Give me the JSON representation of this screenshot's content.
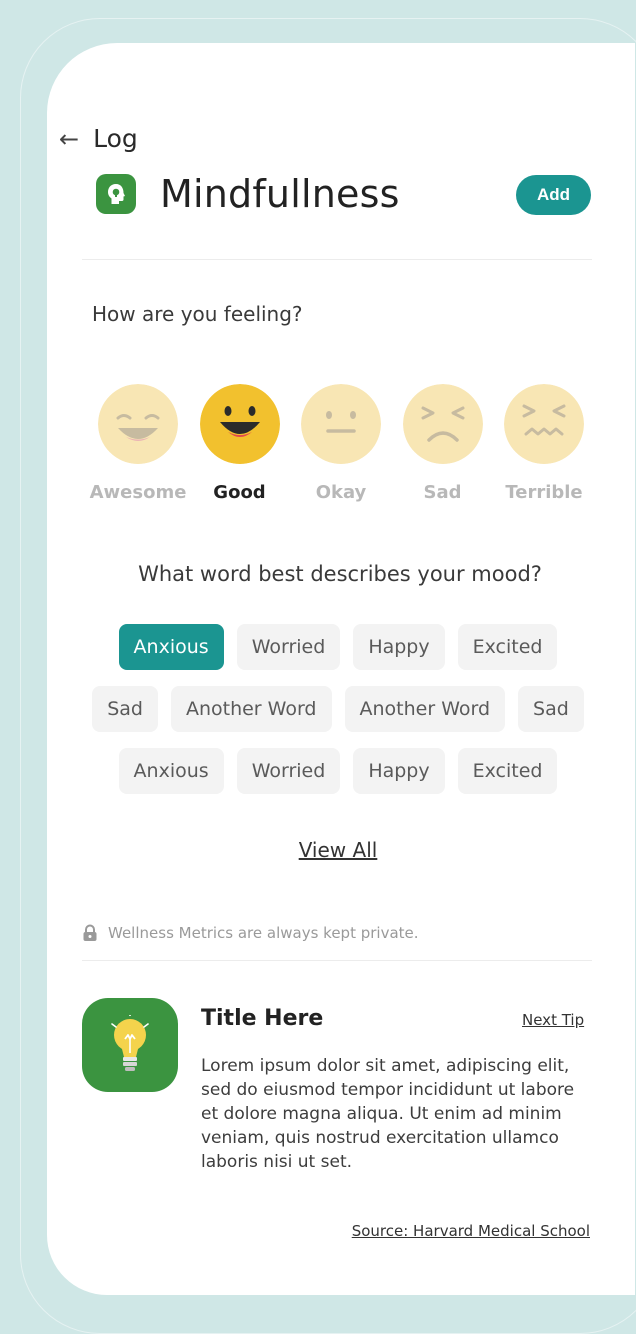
{
  "header": {
    "back_label": "Log",
    "title": "Mindfullness",
    "add_label": "Add"
  },
  "feeling": {
    "question": "How are you feeling?",
    "options": [
      {
        "label": "Awesome",
        "selected": false
      },
      {
        "label": "Good",
        "selected": true
      },
      {
        "label": "Okay",
        "selected": false
      },
      {
        "label": "Sad",
        "selected": false
      },
      {
        "label": "Terrible",
        "selected": false
      }
    ]
  },
  "mood": {
    "question": "What word best describes your mood?",
    "rows": [
      [
        "Anxious",
        "Worried",
        "Happy",
        "Excited"
      ],
      [
        "Sad",
        "Another Word",
        "Another Word",
        "Sad"
      ],
      [
        "Anxious",
        "Worried",
        "Happy",
        "Excited"
      ]
    ],
    "selected_word": "Anxious",
    "view_all_label": "View All"
  },
  "privacy_note": "Wellness Metrics are always kept private.",
  "tip": {
    "title": "Title Here",
    "next_label": "Next Tip",
    "body": "Lorem ipsum dolor sit amet, adipiscing elit, sed do eiusmod tempor incididunt ut labore et dolore magna aliqua. Ut enim ad minim veniam, quis nostrud exercitation ullamco laboris nisi ut set.",
    "source": "Source: Harvard Medical School"
  },
  "colors": {
    "accent": "#1b9591",
    "icon_green": "#3b9440",
    "face_selected": "#f2c12e",
    "face_idle": "#f8e6b4",
    "background": "#cfe7e6"
  },
  "icons": {
    "back": "arrow-left-icon",
    "app": "mind-head-icon",
    "lock": "lock-icon",
    "tip": "lightbulb-icon"
  }
}
